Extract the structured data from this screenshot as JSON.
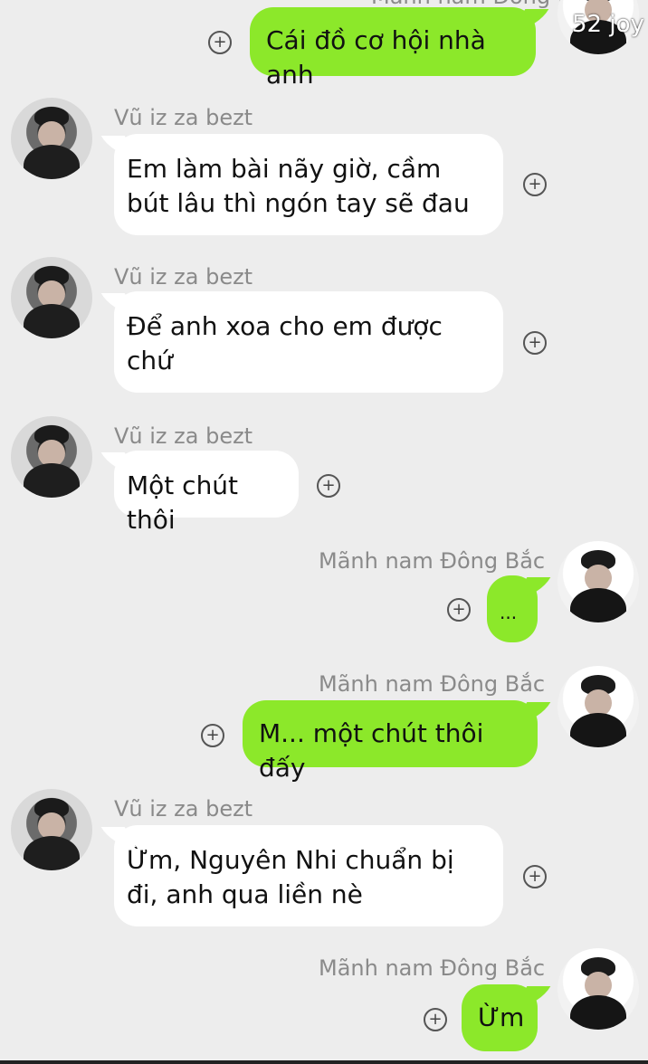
{
  "top": {
    "partial_sender": "Mãnh nam Đông Bắc",
    "bubble": "Cái đồ cơ hội nhà anh",
    "avatar_badge": "52 joy"
  },
  "messages": [
    {
      "sender": "Vũ iz za bezt",
      "text": "Em làm bài nãy giờ, cầm bút lâu thì ngón tay sẽ đau"
    },
    {
      "sender": "Vũ iz za bezt",
      "text": "Để anh xoa cho em được chứ"
    },
    {
      "sender": "Vũ iz za bezt",
      "text": "Một chút thôi"
    },
    {
      "sender": "Mãnh nam Đông Bắc",
      "text": "..."
    },
    {
      "sender": "Mãnh nam Đông Bắc",
      "text": "M... một chút thôi đấy"
    },
    {
      "sender": "Vũ iz za bezt",
      "text": "Ừm, Nguyên Nhi chuẩn bị đi, anh qua liền nè"
    },
    {
      "sender": "Mãnh nam Đông Bắc",
      "text": "Ừm"
    }
  ],
  "icons": {
    "add": "+",
    "add_icon_name": "plus-circle-icon"
  },
  "colors": {
    "background": "#ededed",
    "incoming_bubble": "#ffffff",
    "outgoing_bubble": "#8ce82a"
  }
}
